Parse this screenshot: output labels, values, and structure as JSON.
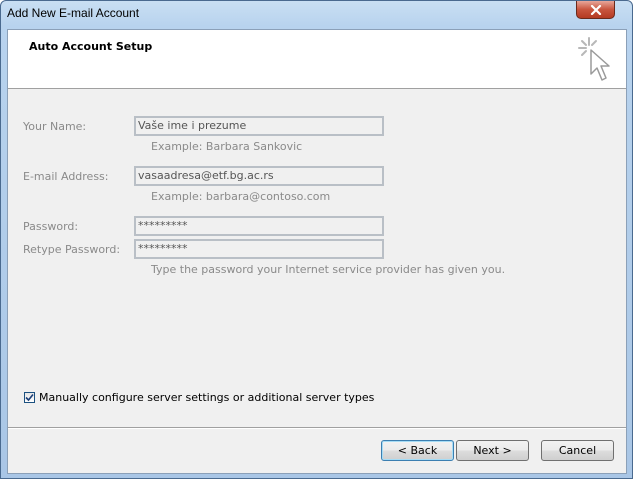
{
  "window": {
    "title": "Add New E-mail Account"
  },
  "header": {
    "title": "Auto Account Setup"
  },
  "form": {
    "name": {
      "label": "Your Name:",
      "value": "Vaše ime i prezume",
      "example": "Example: Barbara Sankovic"
    },
    "email": {
      "label": "E-mail Address:",
      "value": "vasaadresa@etf.bg.ac.rs",
      "example": "Example: barbara@contoso.com"
    },
    "password": {
      "label": "Password:",
      "value": "*********"
    },
    "retype": {
      "label": "Retype Password:",
      "value": "*********"
    },
    "password_hint": "Type the password your Internet service provider has given you."
  },
  "manual_config": {
    "label": "Manually configure server settings or additional server types",
    "checked": true
  },
  "buttons": {
    "back": "< Back",
    "next": "Next >",
    "cancel": "Cancel"
  },
  "icons": {
    "close": "close-icon",
    "header": "cursor-click-icon",
    "check": "checkmark-icon"
  }
}
